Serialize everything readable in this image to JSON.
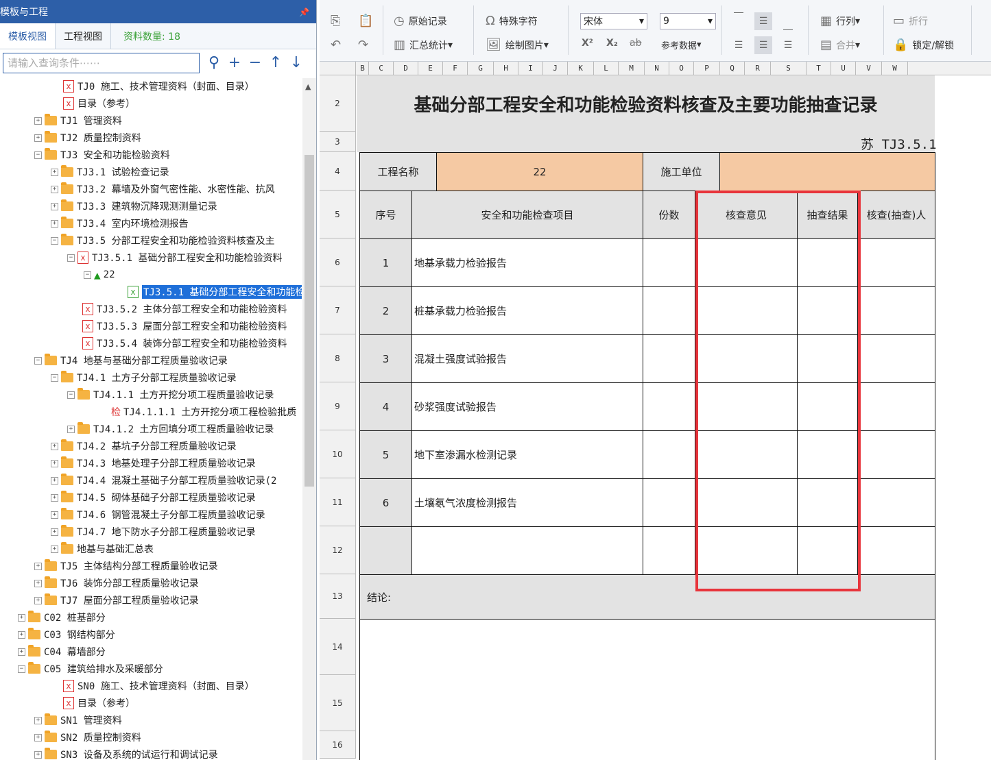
{
  "panel": {
    "title": "模板与工程",
    "pin": "ᅟ",
    "tabs": [
      "模板视图",
      "工程视图"
    ],
    "count_label": "资料数量: 18",
    "search_placeholder": "请输入查询条件⋯⋯",
    "tool_icons": [
      "search-icon",
      "plus-icon",
      "minus-icon",
      "up-arrow-icon",
      "down-arrow-icon"
    ]
  },
  "tree": [
    {
      "t": "file",
      "label": "TJ0 施工、技术管理资料（封面、目录）"
    },
    {
      "t": "file",
      "label": "目录（参考）"
    },
    {
      "t": "folder",
      "label": "TJ1 管理资料",
      "exp": "+"
    },
    {
      "t": "folder",
      "label": "TJ2 质量控制资料",
      "exp": "+"
    },
    {
      "t": "folder",
      "label": "TJ3 安全和功能检验资料",
      "exp": "-"
    },
    {
      "t": "folder",
      "label": "TJ3.1 试验检查记录",
      "exp": "+"
    },
    {
      "t": "folder",
      "label": "TJ3.2 幕墙及外窗气密性能、水密性能、抗风",
      "exp": "+"
    },
    {
      "t": "folder",
      "label": "TJ3.3 建筑物沉降观测测量记录",
      "exp": "+"
    },
    {
      "t": "folder",
      "label": "TJ3.4 室内环境检测报告",
      "exp": "+"
    },
    {
      "t": "folder",
      "label": "TJ3.5 分部工程安全和功能检验资料核查及主",
      "exp": "-"
    },
    {
      "t": "file",
      "label": "TJ3.5.1 基础分部工程安全和功能检验资料",
      "exp": "-"
    },
    {
      "t": "home",
      "label": "22",
      "exp": "-"
    },
    {
      "t": "green",
      "label": "TJ3.5.1 基础分部工程安全和功能检",
      "selected": true
    },
    {
      "t": "file",
      "label": "TJ3.5.2 主体分部工程安全和功能检验资料"
    },
    {
      "t": "file",
      "label": "TJ3.5.3 屋面分部工程安全和功能检验资料"
    },
    {
      "t": "file",
      "label": "TJ3.5.4 装饰分部工程安全和功能检验资料"
    },
    {
      "t": "folder",
      "label": "TJ4 地基与基础分部工程质量验收记录",
      "exp": "-"
    },
    {
      "t": "folder",
      "label": "TJ4.1 土方子分部工程质量验收记录",
      "exp": "-"
    },
    {
      "t": "folder",
      "label": "TJ4.1.1 土方开挖分项工程质量验收记录",
      "exp": "-"
    },
    {
      "t": "jian",
      "label": "TJ4.1.1.1 土方开挖分项工程检验批质"
    },
    {
      "t": "folder",
      "label": "TJ4.1.2 土方回填分项工程质量验收记录",
      "exp": "+"
    },
    {
      "t": "folder",
      "label": "TJ4.2 基坑子分部工程质量验收记录",
      "exp": "+"
    },
    {
      "t": "folder",
      "label": "TJ4.3 地基处理子分部工程质量验收记录",
      "exp": "+"
    },
    {
      "t": "folder",
      "label": "TJ4.4 混凝土基础子分部工程质量验收记录(2",
      "exp": "+"
    },
    {
      "t": "folder",
      "label": "TJ4.5 砌体基础子分部工程质量验收记录",
      "exp": "+"
    },
    {
      "t": "folder",
      "label": "TJ4.6 钢管混凝土子分部工程质量验收记录",
      "exp": "+"
    },
    {
      "t": "folder",
      "label": "TJ4.7 地下防水子分部工程质量验收记录",
      "exp": "+"
    },
    {
      "t": "folder",
      "label": "地基与基础汇总表",
      "exp": "+"
    },
    {
      "t": "folder",
      "label": "TJ5 主体结构分部工程质量验收记录",
      "exp": "+"
    },
    {
      "t": "folder",
      "label": "TJ6 装饰分部工程质量验收记录",
      "exp": "+"
    },
    {
      "t": "folder",
      "label": "TJ7 屋面分部工程质量验收记录",
      "exp": "+"
    },
    {
      "t": "folder",
      "label": "C02 桩基部分",
      "exp": "+"
    },
    {
      "t": "folder",
      "label": "C03 钢结构部分",
      "exp": "+"
    },
    {
      "t": "folder",
      "label": "C04 幕墙部分",
      "exp": "+"
    },
    {
      "t": "folder",
      "label": "C05 建筑给排水及采暖部分",
      "exp": "-"
    },
    {
      "t": "file",
      "label": "SN0 施工、技术管理资料（封面、目录）"
    },
    {
      "t": "file",
      "label": "目录（参考）"
    },
    {
      "t": "folder",
      "label": "SN1 管理资料",
      "exp": "+"
    },
    {
      "t": "folder",
      "label": "SN2 质量控制资料",
      "exp": "+"
    },
    {
      "t": "folder",
      "label": "SN3 设备及系统的试运行和调试记录",
      "exp": "+"
    }
  ],
  "ribbon": {
    "yuanshi": "原始记录",
    "huizong": "汇总统计",
    "teshu": "特殊字符",
    "huizhi": "绘制图片",
    "font": "宋体",
    "size": "9",
    "canshu": "参考数据",
    "hanglie": "行列",
    "hebing": "合并",
    "zhehang": "折行",
    "suoding": "锁定/解锁",
    "sup": "X²",
    "sub": "X₂",
    "strike": "ab"
  },
  "columns": [
    "B",
    "C",
    "D",
    "E",
    "F",
    "G",
    "H",
    "I",
    "J",
    "K",
    "L",
    "M",
    "N",
    "O",
    "P",
    "Q",
    "R",
    "S",
    "T",
    "U",
    "V",
    "W"
  ],
  "rows": [
    "2",
    "3",
    "4",
    "5",
    "6",
    "7",
    "8",
    "9",
    "10",
    "11",
    "12",
    "13",
    "14",
    "15",
    "16"
  ],
  "sheet": {
    "title": "基础分部工程安全和功能检验资料核查及主要功能抽查记录",
    "code": "苏 TJ3.5.1",
    "project_label": "工程名称",
    "project_value": "22",
    "unit_label": "施工单位",
    "headers": [
      "序号",
      "安全和功能检查项目",
      "份数",
      "核查意见",
      "抽查结果",
      "核查(抽查)人"
    ],
    "items": [
      {
        "no": "1",
        "name": "地基承载力检验报告"
      },
      {
        "no": "2",
        "name": "桩基承载力检验报告"
      },
      {
        "no": "3",
        "name": "混凝土强度试验报告"
      },
      {
        "no": "4",
        "name": "砂浆强度试验报告"
      },
      {
        "no": "5",
        "name": "地下室渗漏水检测记录"
      },
      {
        "no": "6",
        "name": "土壤氡气浓度检测报告"
      }
    ],
    "conclusion": "结论:"
  },
  "colors": {
    "accent": "#2d5fa8",
    "orange_cell": "#f5c9a3",
    "highlight": "#e8343b",
    "selection": "#1e6fd9"
  }
}
